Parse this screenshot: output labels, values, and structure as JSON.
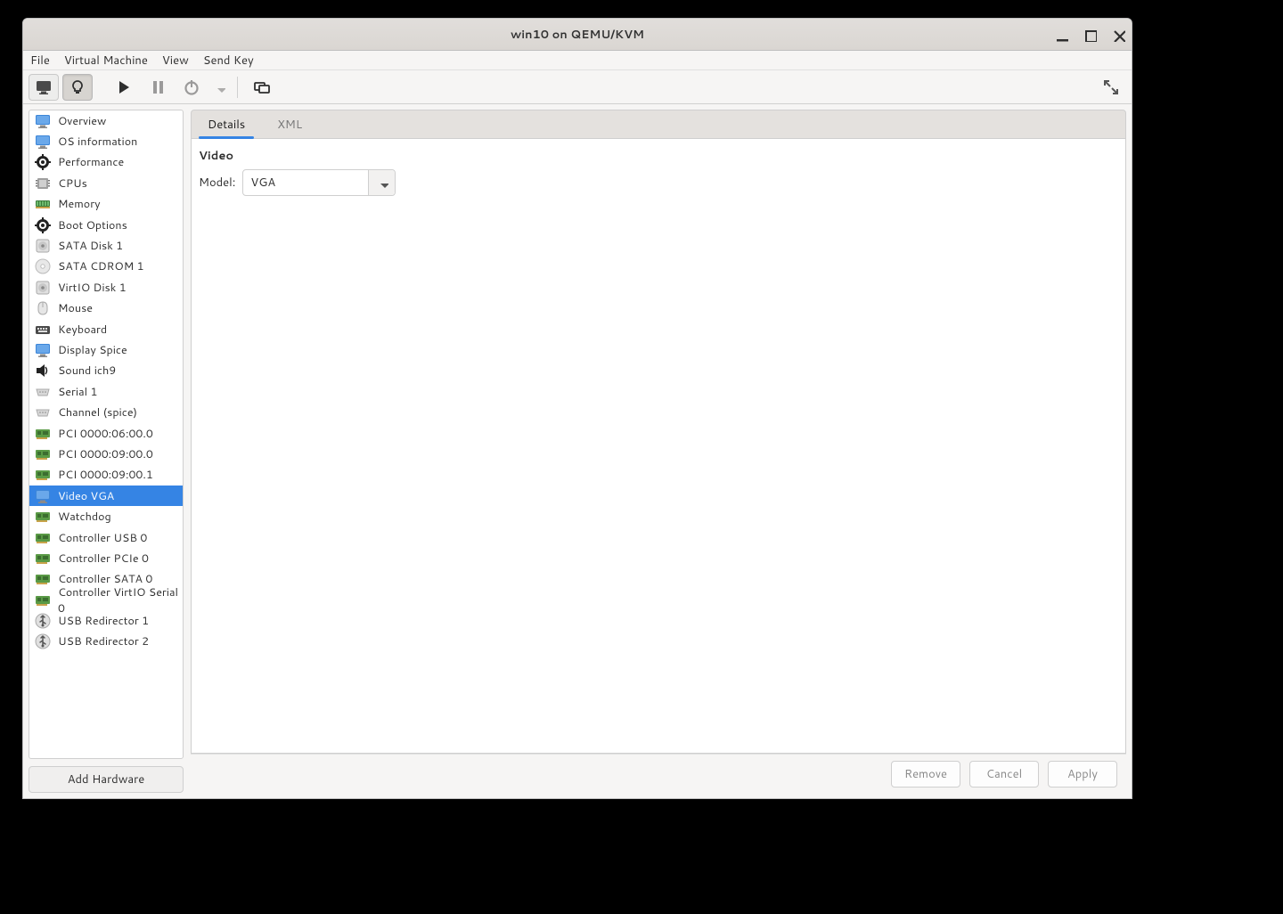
{
  "window": {
    "title": "win10 on QEMU/KVM"
  },
  "menubar": {
    "file": "File",
    "vm": "Virtual Machine",
    "view": "View",
    "sendkey": "Send Key"
  },
  "sidebar": {
    "items": [
      {
        "label": "Overview",
        "icon": "monitor-blue"
      },
      {
        "label": "OS information",
        "icon": "monitor-blue"
      },
      {
        "label": "Performance",
        "icon": "gear-black"
      },
      {
        "label": "CPUs",
        "icon": "chip"
      },
      {
        "label": "Memory",
        "icon": "ram"
      },
      {
        "label": "Boot Options",
        "icon": "gear-black"
      },
      {
        "label": "SATA Disk 1",
        "icon": "disk"
      },
      {
        "label": "SATA CDROM 1",
        "icon": "cdrom"
      },
      {
        "label": "VirtIO Disk 1",
        "icon": "disk"
      },
      {
        "label": "Mouse",
        "icon": "mouse"
      },
      {
        "label": "Keyboard",
        "icon": "keyboard"
      },
      {
        "label": "Display Spice",
        "icon": "monitor-blue"
      },
      {
        "label": "Sound ich9",
        "icon": "sound"
      },
      {
        "label": "Serial 1",
        "icon": "serial"
      },
      {
        "label": "Channel (spice)",
        "icon": "serial"
      },
      {
        "label": "PCI 0000:06:00.0",
        "icon": "card"
      },
      {
        "label": "PCI 0000:09:00.0",
        "icon": "card"
      },
      {
        "label": "PCI 0000:09:00.1",
        "icon": "card"
      },
      {
        "label": "Video VGA",
        "icon": "monitor-blue"
      },
      {
        "label": "Watchdog",
        "icon": "card"
      },
      {
        "label": "Controller USB 0",
        "icon": "card"
      },
      {
        "label": "Controller PCIe 0",
        "icon": "card"
      },
      {
        "label": "Controller SATA 0",
        "icon": "card"
      },
      {
        "label": "Controller VirtIO Serial 0",
        "icon": "card"
      },
      {
        "label": "USB Redirector 1",
        "icon": "usb"
      },
      {
        "label": "USB Redirector 2",
        "icon": "usb"
      }
    ],
    "selected_index": 18
  },
  "add_hardware_label": "Add Hardware",
  "tabs": {
    "details": "Details",
    "xml": "XML"
  },
  "detail": {
    "section": "Video",
    "model_label": "Model:",
    "model_value": "VGA"
  },
  "buttons": {
    "remove": "Remove",
    "cancel": "Cancel",
    "apply": "Apply"
  }
}
